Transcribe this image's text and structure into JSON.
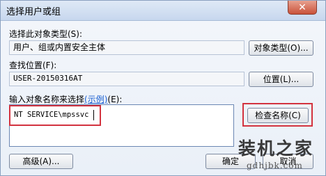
{
  "window": {
    "title": "选择用户或组"
  },
  "section_object_type": {
    "label": "选择此对象类型(S):",
    "value": "用户、组或内置安全主体",
    "button": "对象类型(O)..."
  },
  "section_location": {
    "label": "查找位置(F):",
    "value": "USER-20150316AT",
    "button": "位置(L)..."
  },
  "section_names": {
    "label_prefix": "输入对象名称来选择",
    "label_link": "(示例)",
    "label_suffix": "(E):",
    "value": "NT SERVICE\\mpssvc",
    "check_button": "检查名称(C)"
  },
  "footer": {
    "advanced_button": "高级(A)...",
    "ok_button": "确定",
    "cancel_button": "取消"
  },
  "watermark": {
    "title": "装机之家",
    "url": "gdhjbk.com"
  },
  "colors": {
    "highlight_box": "#d3333f",
    "link": "#1a5fd1"
  }
}
